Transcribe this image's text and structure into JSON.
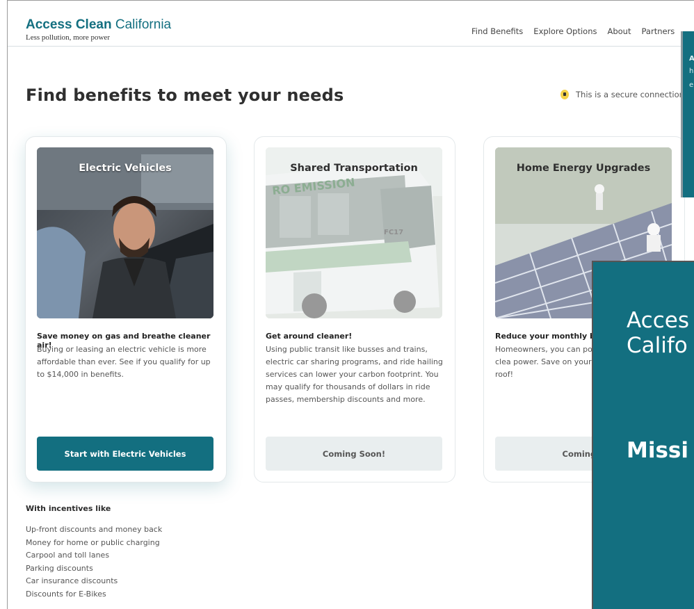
{
  "header": {
    "brand_bold": "Access Clean",
    "brand_light": "California",
    "tagline": "Less pollution, more power",
    "nav": [
      "Find Benefits",
      "Explore Options",
      "About",
      "Partners"
    ]
  },
  "page": {
    "title": "Find benefits to meet your needs",
    "secure_text": "This is a secure connection"
  },
  "cards": [
    {
      "label": "Electric Vehicles",
      "headline": "Save money on gas and breathe cleaner air!",
      "body": "Buying or leasing an electric vehicle is more affordable than ever. See if you qualify for up to $14,000 in benefits.",
      "button": "Start with Electric Vehicles"
    },
    {
      "label": "Shared Transportation",
      "headline": "Get around cleaner!",
      "body": "Using public transit like busses and trains, electric car sharing programs, and ride hailing services can lower your carbon footprint. You may qualify for thousands of dollars in ride passes, membership discounts and more.",
      "button": "Coming Soon!"
    },
    {
      "label": "Home Energy Upgrades",
      "headline": "Reduce your monthly bil",
      "body": "Homeowners, you can po electric vehicle with clea power. Save on your elec solar on your roof!",
      "button": "Coming S"
    }
  ],
  "incentives": {
    "title": "With incentives like",
    "items": [
      "Up-front discounts and money back",
      "Money for home or public charging",
      "Carpool and toll lanes",
      "Parking discounts",
      "Car insurance discounts",
      "Discounts for E-Bikes"
    ]
  },
  "overlay": {
    "side_letters": [
      "A",
      "h",
      "e"
    ],
    "title_line1": "Acces",
    "title_line2": "Califo",
    "mission": "Missi"
  },
  "colors": {
    "brand": "#136f80",
    "disabled_button": "#e9eeef",
    "secure_icon": "#f4d24a"
  }
}
